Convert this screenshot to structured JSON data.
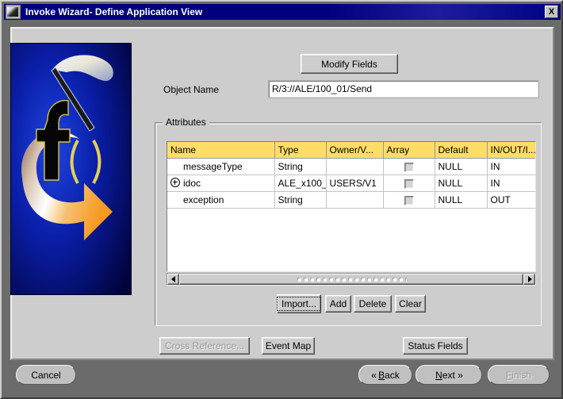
{
  "window": {
    "title": "Invoke Wizard- Define Application View",
    "icon": "magic-wand-icon",
    "close_label": "X"
  },
  "colors": {
    "titlebar": "#00007E",
    "dialog_background": "#CDCDCD",
    "frame": "#6B6B6B",
    "table_header": "#FFDD66",
    "logo_blue": "#0A1EA8",
    "logo_orange": "#F79A22"
  },
  "toolbar": {
    "modify_fields_label": "Modify Fields"
  },
  "object_name": {
    "label": "Object Name",
    "value": "R/3://ALE/100_01/Send",
    "placeholder": ""
  },
  "attributes": {
    "legend": "Attributes",
    "columns": [
      "Name",
      "Type",
      "Owner/V...",
      "Array",
      "Default",
      "IN/OUT/I..."
    ],
    "rows": [
      {
        "expandable": false,
        "name": "messageType",
        "type": "String",
        "owner": "",
        "array": false,
        "default": "NULL",
        "inout": "IN"
      },
      {
        "expandable": true,
        "toggle": "expand-plus-icon",
        "name": "idoc",
        "type": "ALE_x100_",
        "owner": "USERS/V1",
        "array": false,
        "default": "NULL",
        "inout": "IN"
      },
      {
        "expandable": false,
        "name": "exception",
        "type": "String",
        "owner": "",
        "array": false,
        "default": "NULL",
        "inout": "OUT"
      }
    ],
    "buttons": {
      "import_label": "Import...",
      "add_label": "Add",
      "delete_label": "Delete",
      "clear_label": "Clear"
    }
  },
  "scrollbar": {
    "left_arrow": "arrow-left-icon",
    "right_arrow": "arrow-right-icon"
  },
  "lower_actions": {
    "cross_reference_label": "Cross Reference...",
    "event_map_label": "Event Map",
    "status_fields_label": "Status Fields"
  },
  "wizard_nav": {
    "cancel_label": "Cancel",
    "back_prefix": "«",
    "back_mnemonic": "B",
    "back_rest": "ack",
    "next_mnemonic": "N",
    "next_rest": "ext",
    "next_suffix": "»",
    "finish_mnemonic": "F",
    "finish_rest": "inish"
  }
}
